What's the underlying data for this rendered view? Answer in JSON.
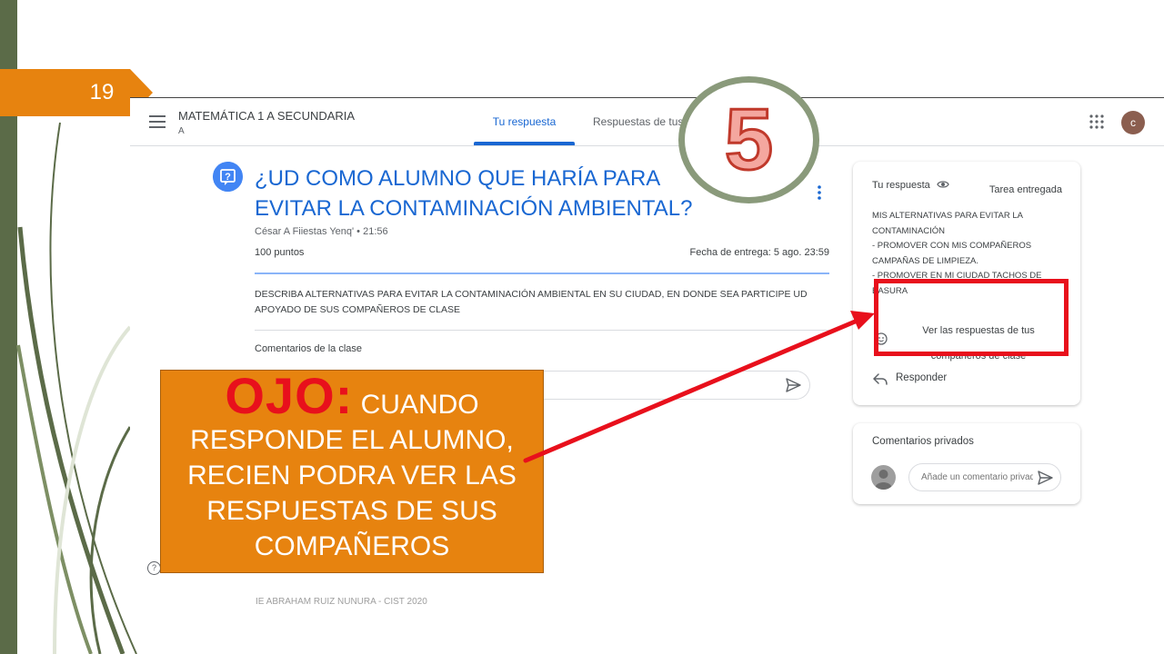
{
  "slide": {
    "number": "19"
  },
  "classroom": {
    "class_name": "MATEMÁTICA 1 A SECUNDARIA",
    "class_section": "A",
    "tabs": [
      {
        "label": "Tu respuesta",
        "active": true
      },
      {
        "label": "Respuestas de tus",
        "active": false
      }
    ],
    "avatar_letter": "c",
    "assignment": {
      "title": "¿UD COMO ALUMNO QUE HARÍA PARA EVITAR LA CONTAMINACIÓN AMBIENTAL?",
      "author": "César A Fiiestas Yenq' • 21:56",
      "points": "100 puntos",
      "due": "Fecha de entrega: 5 ago. 23:59",
      "description": "DESCRIBA ALTERNATIVAS PARA EVITAR LA CONTAMINACIÓN AMBIENTAL  EN SU CIUDAD, EN DONDE SEA PARTICIPE UD APOYADO DE SUS COMPAÑEROS DE CLASE",
      "class_comments_label": "Comentarios de la clase"
    },
    "response_card": {
      "title": "Tu respuesta",
      "status": "Tarea entregada",
      "body_lines": [
        "MIS ALTERNATIVAS PARA EVITAR LA",
        "CONTAMINACIÓN",
        "- PROMOVER CON MIS COMPAÑEROS",
        "CAMPAÑAS DE LIMPIEZA.",
        "- PROMOVER EN MI CIUDAD TACHOS DE",
        "BASURA"
      ],
      "view_classmates": "Ver las respuestas de tus compañeros de clase",
      "reply": "Responder"
    },
    "private_comments": {
      "label": "Comentarios privados",
      "placeholder": "Añade un comentario privado"
    },
    "footer": "IE ABRAHAM RUIZ NUNURA - CIST 2020"
  },
  "callout": {
    "lead": "OJO:",
    "text": "CUANDO RESPONDE EL ALUMNO, RECIEN PODRA VER LAS RESPUESTAS DE SUS COMPAÑEROS"
  },
  "step": {
    "number": "5"
  },
  "colors": {
    "accent_blue": "#1967d2",
    "callout_orange": "#e7830f",
    "highlight_red": "#e8101c",
    "circle_green": "#8a9a7b"
  }
}
